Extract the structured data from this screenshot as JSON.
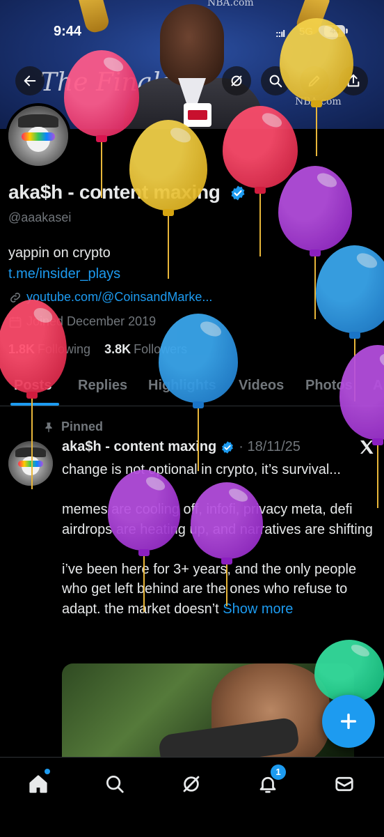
{
  "status": {
    "time": "9:44",
    "signal": "::ıl",
    "network": "5G",
    "battery": "44"
  },
  "header": {
    "banner_text_left": "The Finals",
    "banner_text_right": "NBA.com",
    "banner_text_top": "NBA.com"
  },
  "profile": {
    "name": "aka$h - content maxing",
    "handle": "@aaakasei",
    "bio": "yappin on crypto",
    "bio_link": "t.me/insider_plays",
    "website": "youtube.com/@CoinsandMarke...",
    "joined": "Joined December 2019",
    "following_count": "1.8K",
    "following_label": "Following",
    "followers_count": "3.8K",
    "followers_label": "Followers"
  },
  "tabs": [
    {
      "label": "Posts"
    },
    {
      "label": "Replies"
    },
    {
      "label": "Highlights"
    },
    {
      "label": "Videos"
    },
    {
      "label": "Photos"
    },
    {
      "label": "A"
    }
  ],
  "post": {
    "pinned_label": "Pinned",
    "author_name": "aka$h - content maxing",
    "date": "· 18/11/25",
    "paragraph1": "change is not optional in crypto, it’s survival...",
    "paragraph2": "memes are cooling off, infofi, privacy meta, defi airdrops are heating up, and narratives are shifting",
    "paragraph3": "i’ve been here for 3+ years, and the only people who get left behind are the ones who refuse to adapt. the market doesn’t",
    "show_more": "Show more"
  },
  "nav": {
    "notifications_badge": "1"
  },
  "icons": [
    "back-arrow-icon",
    "grok-icon",
    "search-icon",
    "edit-icon",
    "share-icon",
    "verified-icon",
    "link-icon",
    "calendar-icon",
    "pin-icon",
    "x-logo-icon",
    "plus-icon",
    "home-icon",
    "notifications-icon",
    "mail-icon"
  ],
  "colors": {
    "accent": "#1d9bf0",
    "background": "#000000",
    "text": "#e7e9ea",
    "muted": "#71767b"
  }
}
